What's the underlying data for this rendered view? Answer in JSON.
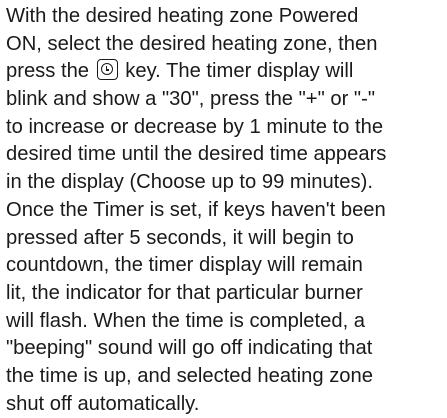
{
  "document": {
    "lines": [
      "With the desired heating zone Powered",
      "ON, select the desired heating zone, then",
      "key. The timer display will",
      "blink and show a \"30\", press the \"+\" or \"-\"",
      "to increase or decrease by 1 minute to the",
      "desired time until the desired time appears",
      "in the display (Choose up to 99 minutes).",
      "Once the Timer is set, if keys haven't been",
      "pressed after 5 seconds, it will begin to",
      "countdown, the timer display will remain",
      "lit, the indicator for that particular burner",
      "will flash. When the time is completed, a",
      "\"beeping\" sound will go off indicating that",
      "the time is up, and selected heating zone",
      "shut off automatically."
    ],
    "line3_prefix": "press the",
    "timer_key_icon": "timer-clock-icon"
  }
}
